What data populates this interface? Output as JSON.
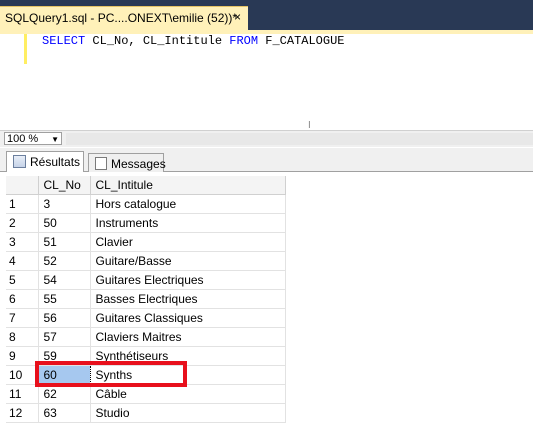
{
  "tab": {
    "title": "SQLQuery1.sql - PC....ONEXT\\emilie (52))*",
    "close_glyph": "×"
  },
  "editor": {
    "kw_select": "SELECT",
    "cols": " CL_No, CL_Intitule ",
    "kw_from": "FROM",
    "table": " F_CATALOGUE"
  },
  "zoom": {
    "value": "100 %"
  },
  "results_tabs": {
    "results_label": "Résultats",
    "messages_label": "Messages"
  },
  "grid": {
    "columns": [
      "CL_No",
      "CL_Intitule"
    ],
    "rows": [
      [
        "1",
        "3",
        "Hors catalogue"
      ],
      [
        "2",
        "50",
        "Instruments"
      ],
      [
        "3",
        "51",
        "Clavier"
      ],
      [
        "4",
        "52",
        "Guitare/Basse"
      ],
      [
        "5",
        "54",
        "Guitares Electriques"
      ],
      [
        "6",
        "55",
        "Basses Electriques"
      ],
      [
        "7",
        "56",
        "Guitares Classiques"
      ],
      [
        "8",
        "57",
        "Claviers Maitres"
      ],
      [
        "9",
        "59",
        "Synthétiseurs"
      ],
      [
        "10",
        "60",
        "Synths"
      ],
      [
        "11",
        "62",
        "Câble"
      ],
      [
        "12",
        "63",
        "Studio"
      ]
    ],
    "selected_row": 9
  },
  "colors": {
    "highlight": "#e8101c",
    "selection": "#a6c8ef",
    "tab_active": "#fff1b9",
    "chrome": "#293955"
  }
}
